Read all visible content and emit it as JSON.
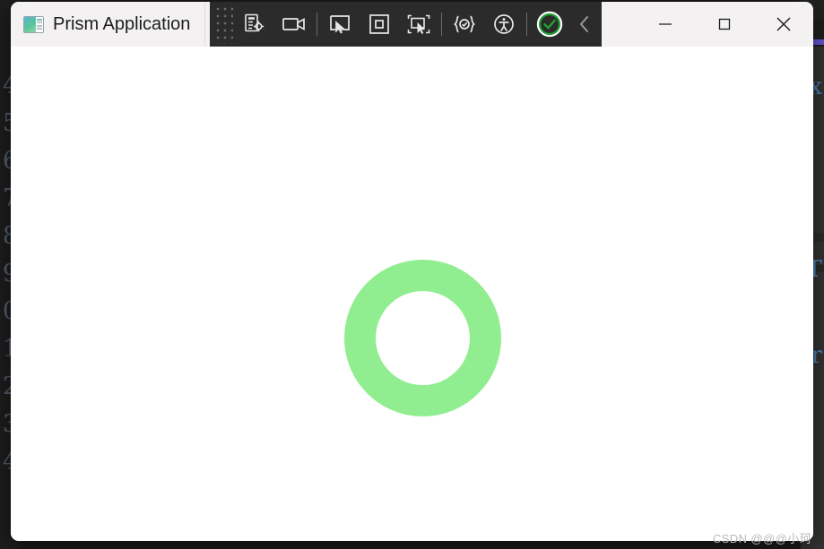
{
  "backdrop": {
    "gutter_line_numbers": [
      "4",
      "5",
      "6",
      "7",
      "8",
      "9",
      "0",
      "1",
      "2",
      "3",
      "4"
    ],
    "right_edge_chars": [
      "x",
      "T",
      "r"
    ],
    "accent_color": "#6257d6"
  },
  "window": {
    "title": "Prism Application",
    "app_icon_name": "prism-app-icon",
    "controls": {
      "minimize_label": "Minimize",
      "maximize_label": "Maximize",
      "close_label": "Close"
    }
  },
  "dev_toolbar": {
    "grip_label": "Drag toolbar",
    "buttons": [
      {
        "name": "inspect-live-visual-tree-button",
        "tooltip": "Go to Live Visual Tree"
      },
      {
        "name": "record-video-button",
        "tooltip": "Record screen"
      },
      {
        "name": "select-element-button",
        "tooltip": "Select element"
      },
      {
        "name": "display-layout-adorner-button",
        "tooltip": "Display layout adorner"
      },
      {
        "name": "track-focused-element-button",
        "tooltip": "Track focused element"
      },
      {
        "name": "xaml-hot-reload-button",
        "tooltip": "XAML Hot Reload"
      },
      {
        "name": "accessibility-checker-button",
        "tooltip": "Accessibility checker"
      },
      {
        "name": "live-visual-state-ok-button",
        "tooltip": "Hot Reload enabled"
      },
      {
        "name": "collapse-toolbar-button",
        "tooltip": "Collapse"
      }
    ]
  },
  "client": {
    "ring_name": "progress-ring",
    "ring_color": "#90ee90",
    "ring_outer_diameter": 175,
    "ring_thickness": 35
  },
  "watermark": {
    "text": "CSDN @@@小珂"
  }
}
